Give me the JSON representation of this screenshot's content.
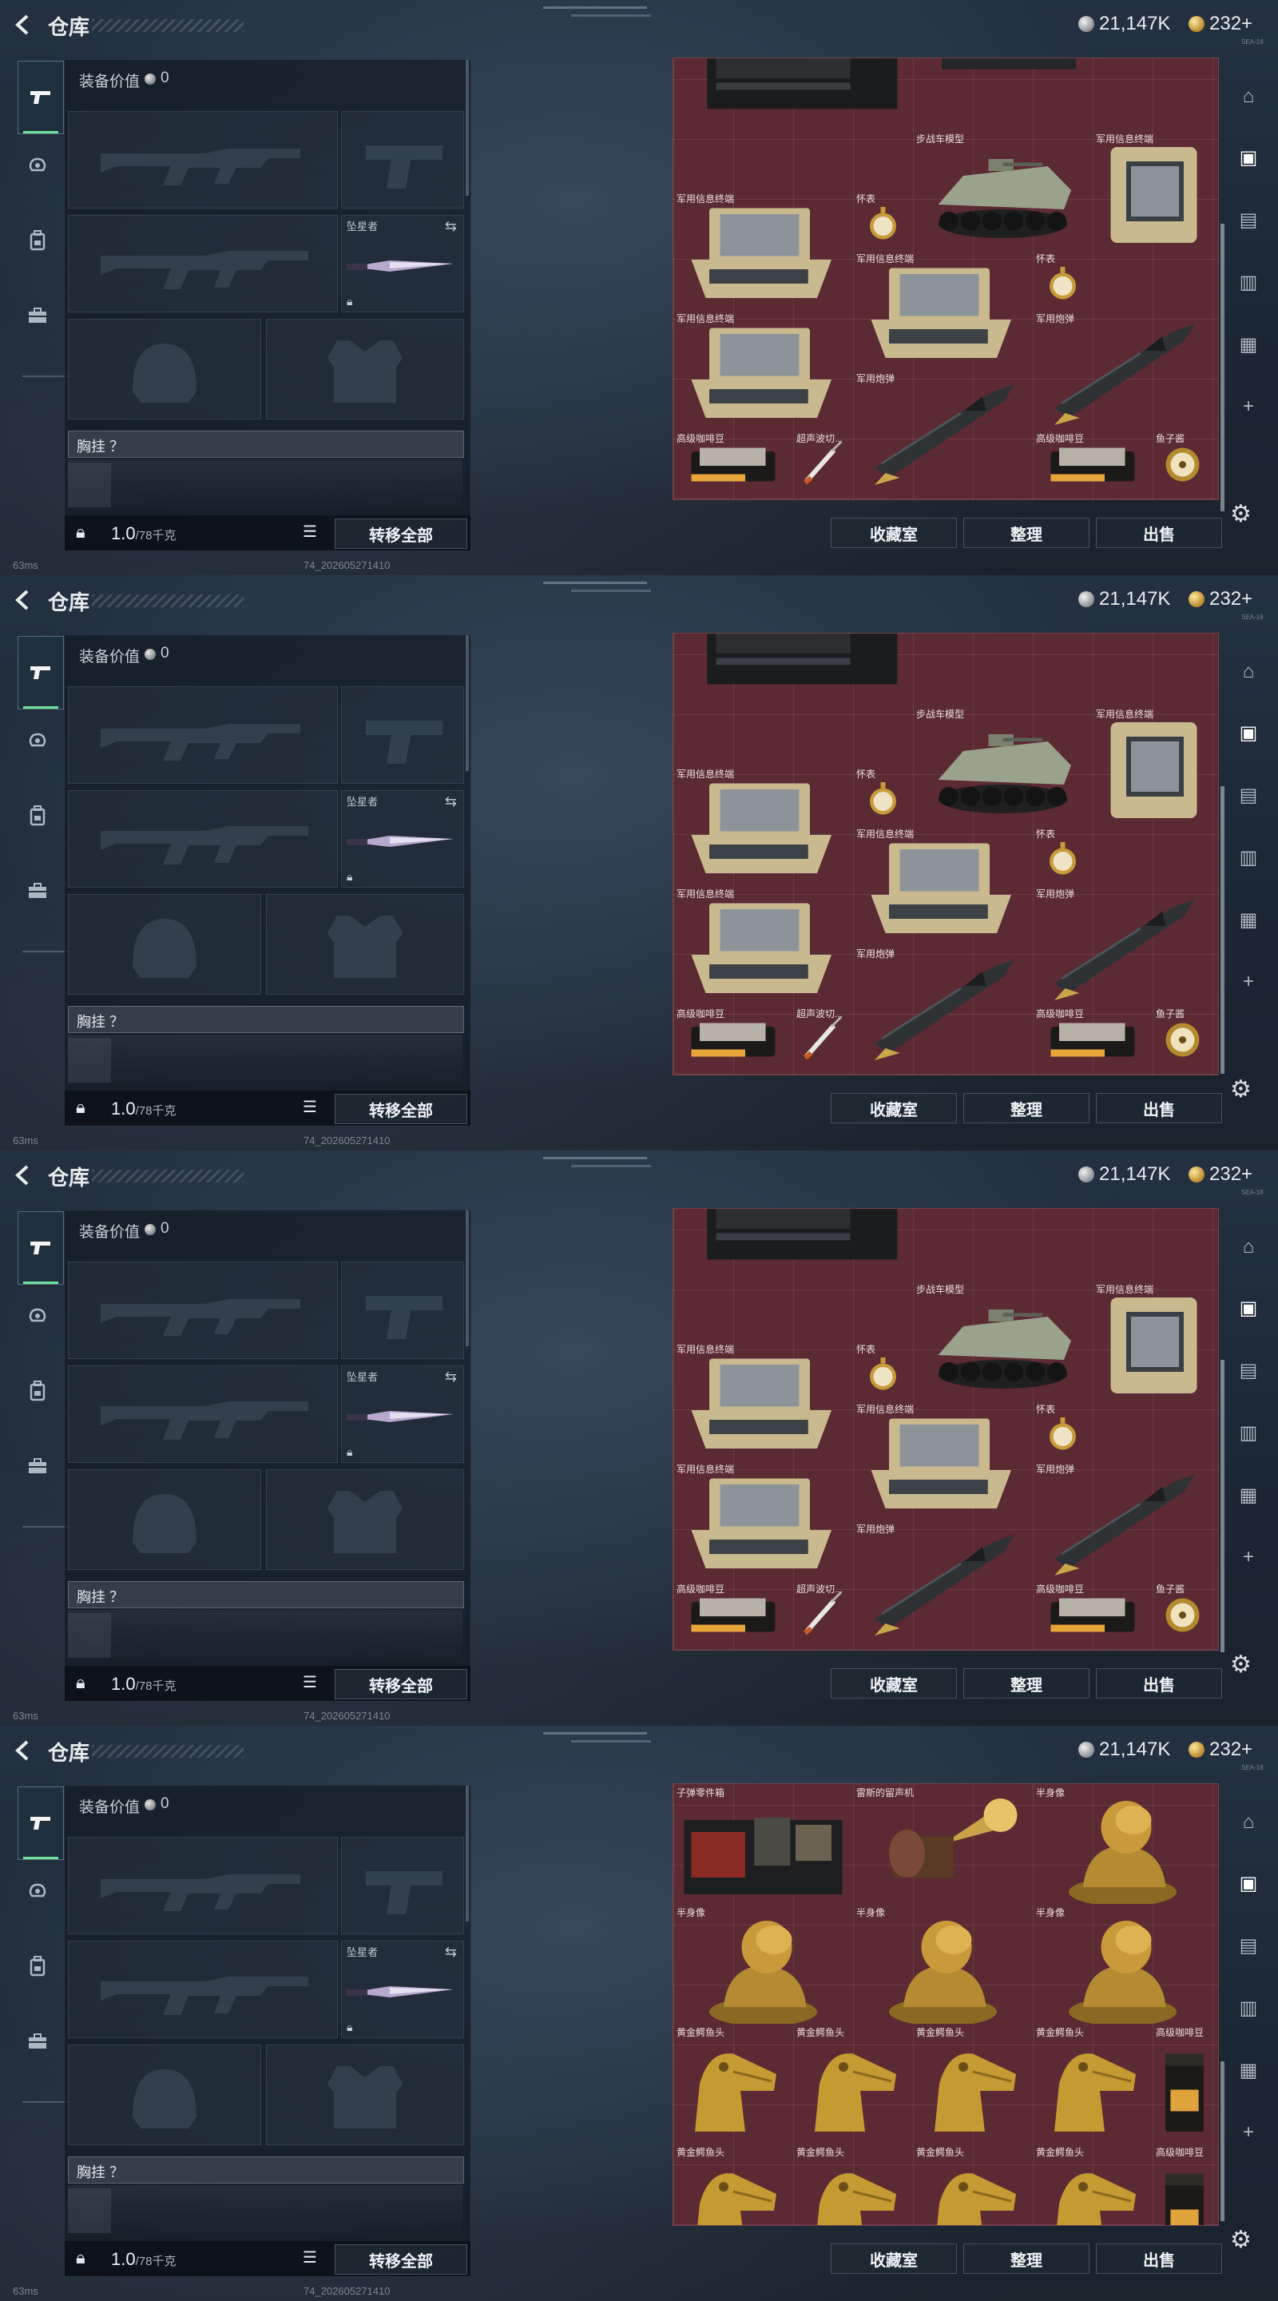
{
  "header": {
    "title": "仓库",
    "silver": "21,147K",
    "gold": "232+",
    "hint": "SEA-18"
  },
  "equipment": {
    "value_label": "装备价值",
    "value": "0",
    "melee_label": "坠星者",
    "chest_label": "胸挂 ？",
    "weight": "1.0",
    "weight_cap": "/78千克",
    "transfer_all": "转移全部"
  },
  "actions": {
    "collection": "收藏室",
    "organize": "整理",
    "sell": "出售"
  },
  "status": {
    "ping": "63ms",
    "version": "74_202605271410"
  },
  "frames": [
    {
      "items": [
        {
          "type": "server",
          "name": ""
        },
        {
          "type": "crate_top",
          "name": ""
        },
        {
          "type": "ivf",
          "name": "步战车模型"
        },
        {
          "type": "terminal_tall",
          "name": "军用信息终端"
        },
        {
          "type": "terminal",
          "name": "军用信息终端"
        },
        {
          "type": "watch",
          "name": "怀表"
        },
        {
          "type": "terminal",
          "name": "军用信息终端"
        },
        {
          "type": "watch",
          "name": "怀表"
        },
        {
          "type": "terminal",
          "name": "军用信息终端"
        },
        {
          "type": "missile",
          "name": "军用炮弹"
        },
        {
          "type": "missile",
          "name": "军用炮弹"
        },
        {
          "type": "coffee",
          "name": "高级咖啡豆"
        },
        {
          "type": "syringe",
          "name": "超声波切..."
        },
        {
          "type": "coffee",
          "name": "高级咖啡豆"
        },
        {
          "type": "compass",
          "name": "鱼子酱"
        }
      ]
    },
    {
      "items": [
        {
          "type": "server",
          "name": ""
        },
        {
          "type": "ivf",
          "name": "步战车模型"
        },
        {
          "type": "terminal_tall",
          "name": "军用信息终端"
        },
        {
          "type": "terminal",
          "name": "军用信息终端"
        },
        {
          "type": "watch",
          "name": "怀表"
        },
        {
          "type": "terminal",
          "name": "军用信息终端"
        },
        {
          "type": "watch",
          "name": "怀表"
        },
        {
          "type": "terminal",
          "name": "军用信息终端"
        },
        {
          "type": "missile",
          "name": "军用炮弹"
        },
        {
          "type": "missile",
          "name": "军用炮弹"
        },
        {
          "type": "coffee",
          "name": "高级咖啡豆"
        },
        {
          "type": "syringe",
          "name": "超声波切..."
        },
        {
          "type": "coffee",
          "name": "高级咖啡豆"
        },
        {
          "type": "compass",
          "name": "鱼子酱"
        }
      ]
    },
    {
      "items": [
        {
          "type": "server",
          "name": ""
        },
        {
          "type": "ivf",
          "name": "步战车模型"
        },
        {
          "type": "terminal_tall",
          "name": "军用信息终端"
        },
        {
          "type": "terminal",
          "name": "军用信息终端"
        },
        {
          "type": "watch",
          "name": "怀表"
        },
        {
          "type": "terminal",
          "name": "军用信息终端"
        },
        {
          "type": "watch",
          "name": "怀表"
        },
        {
          "type": "terminal",
          "name": "军用信息终端"
        },
        {
          "type": "missile",
          "name": "军用炮弹"
        },
        {
          "type": "missile",
          "name": "军用炮弹"
        },
        {
          "type": "coffee",
          "name": "高级咖啡豆"
        },
        {
          "type": "syringe",
          "name": "超声波切..."
        },
        {
          "type": "coffee",
          "name": "高级咖啡豆"
        },
        {
          "type": "compass",
          "name": "鱼子酱"
        }
      ]
    },
    {
      "items": [
        {
          "type": "ammo_kit",
          "name": "子弹零件箱"
        },
        {
          "type": "gramophone",
          "name": "雷斯的留声机"
        },
        {
          "type": "bust",
          "name": "半身像"
        },
        {
          "type": "bust",
          "name": "半身像"
        },
        {
          "type": "bust",
          "name": "半身像"
        },
        {
          "type": "bust",
          "name": "半身像"
        },
        {
          "type": "croc",
          "name": "黄金鳄鱼头"
        },
        {
          "type": "croc",
          "name": "黄金鳄鱼头"
        },
        {
          "type": "croc",
          "name": "黄金鳄鱼头"
        },
        {
          "type": "croc",
          "name": "黄金鳄鱼头"
        },
        {
          "type": "coffee_bag",
          "name": "高级咖啡豆"
        },
        {
          "type": "croc",
          "name": "黄金鳄鱼头"
        },
        {
          "type": "croc",
          "name": "黄金鳄鱼头"
        },
        {
          "type": "croc",
          "name": "黄金鳄鱼头"
        },
        {
          "type": "croc",
          "name": "黄金鳄鱼头"
        },
        {
          "type": "coffee_bag",
          "name": "高级咖啡豆"
        }
      ]
    }
  ],
  "colors": {
    "grid_bg": "#5b2a33",
    "active_tab_accent": "#6fe3a0",
    "panel_bg": "#121a22"
  },
  "icons": [
    "back-arrow-icon",
    "pistol-icon",
    "helmet-icon",
    "backpack-icon",
    "briefcase-icon",
    "lock-icon",
    "list-icon",
    "swap-icon",
    "settings-icon",
    "add-icon"
  ]
}
